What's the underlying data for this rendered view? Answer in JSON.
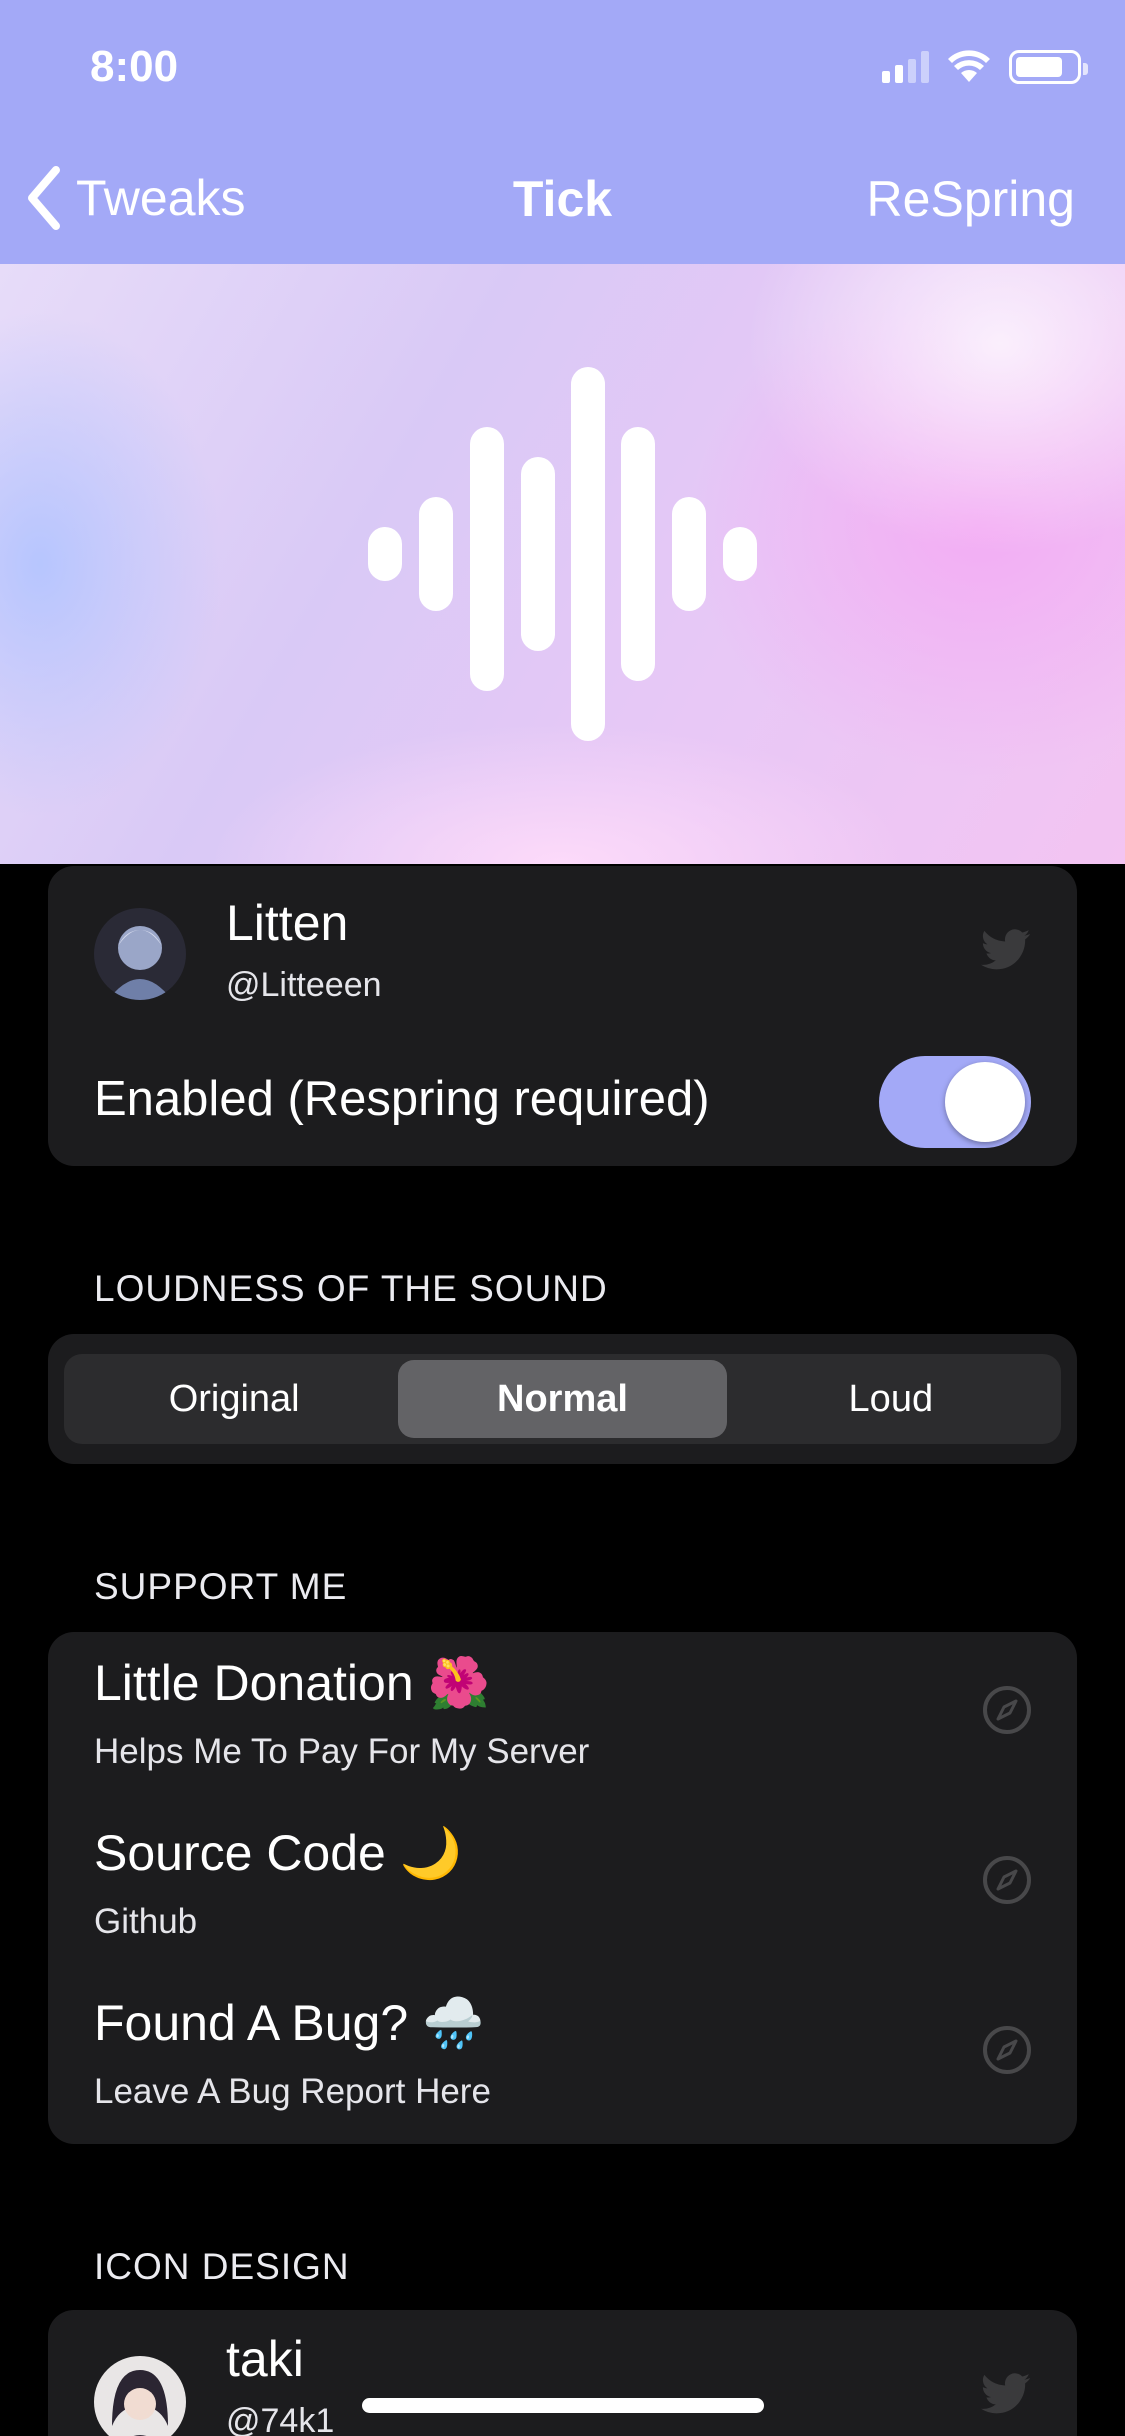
{
  "status_bar": {
    "time": "8:00"
  },
  "nav": {
    "back_label": "Tweaks",
    "title": "Tick",
    "action_label": "ReSpring"
  },
  "author": {
    "name": "Litten",
    "handle": "@Litteeen"
  },
  "enabled": {
    "label": "Enabled (Respring required)",
    "on": true
  },
  "loudness": {
    "section_title": "LOUDNESS OF THE SOUND",
    "options": [
      "Original",
      "Normal",
      "Loud"
    ],
    "selected": "Normal"
  },
  "support": {
    "section_title": "SUPPORT ME",
    "items": [
      {
        "title": "Little Donation 🌺",
        "subtitle": "Helps Me To Pay For My Server"
      },
      {
        "title": "Source Code 🌙",
        "subtitle": "Github"
      },
      {
        "title": "Found A Bug? 🌧️",
        "subtitle": "Leave A Bug Report Here"
      }
    ]
  },
  "icon_design": {
    "section_title": "ICON DESIGN",
    "name": "taki",
    "handle": "@74k1"
  },
  "colors": {
    "accent": "#a3a9f7",
    "card": "#1c1c1e",
    "background": "#000000"
  },
  "icons": {
    "back": "chevron-left-icon",
    "header": "sound-wave-icon",
    "social": "twitter-icon",
    "link": "compass-icon"
  }
}
